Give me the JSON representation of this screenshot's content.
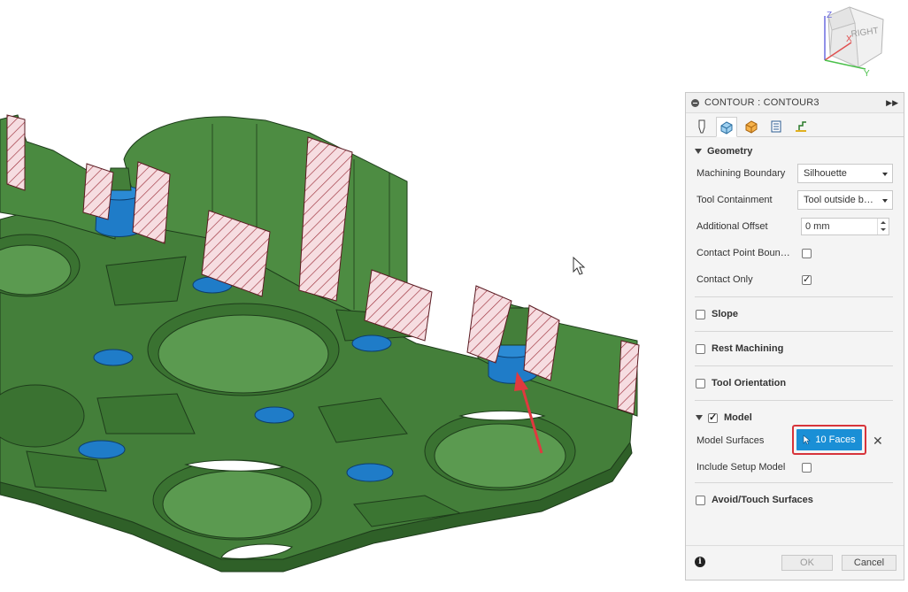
{
  "viewcube": {
    "face_label": "RIGHT",
    "axis_z": "Z",
    "axis_x": "X",
    "axis_y": "Y"
  },
  "panel": {
    "title": "CONTOUR : CONTOUR3",
    "tabs": [
      {
        "icon": "tool-icon"
      },
      {
        "icon": "geometry-icon",
        "active": true
      },
      {
        "icon": "heights-icon"
      },
      {
        "icon": "passes-icon"
      },
      {
        "icon": "linking-icon"
      }
    ],
    "geometry": {
      "label": "Geometry",
      "machining_boundary_label": "Machining Boundary",
      "machining_boundary_value": "Silhouette",
      "tool_containment_label": "Tool Containment",
      "tool_containment_value": "Tool outside boundary",
      "additional_offset_label": "Additional Offset",
      "additional_offset_value": "0 mm",
      "contact_point_label": "Contact Point Boundary",
      "contact_point_checked": false,
      "contact_only_label": "Contact Only",
      "contact_only_checked": true
    },
    "slope": {
      "label": "Slope",
      "checked": false
    },
    "rest_machining": {
      "label": "Rest Machining",
      "checked": false
    },
    "tool_orientation": {
      "label": "Tool Orientation",
      "checked": false
    },
    "model": {
      "label": "Model",
      "checked": true,
      "model_surfaces_label": "Model Surfaces",
      "model_surfaces_value": "10 Faces",
      "include_setup_label": "Include Setup Model",
      "include_setup_checked": false
    },
    "avoid_touch": {
      "label": "Avoid/Touch Surfaces",
      "checked": false
    },
    "footer": {
      "info": "i",
      "ok_label": "OK",
      "cancel_label": "Cancel"
    }
  },
  "colors": {
    "part_green": "#3f7d36",
    "part_green_dark": "#2c5a27",
    "selected_face": "#1f7cc8",
    "hatch_pink": "#f4d8dc",
    "highlight_red": "#d7343b",
    "arrow_red": "#e0393f"
  }
}
